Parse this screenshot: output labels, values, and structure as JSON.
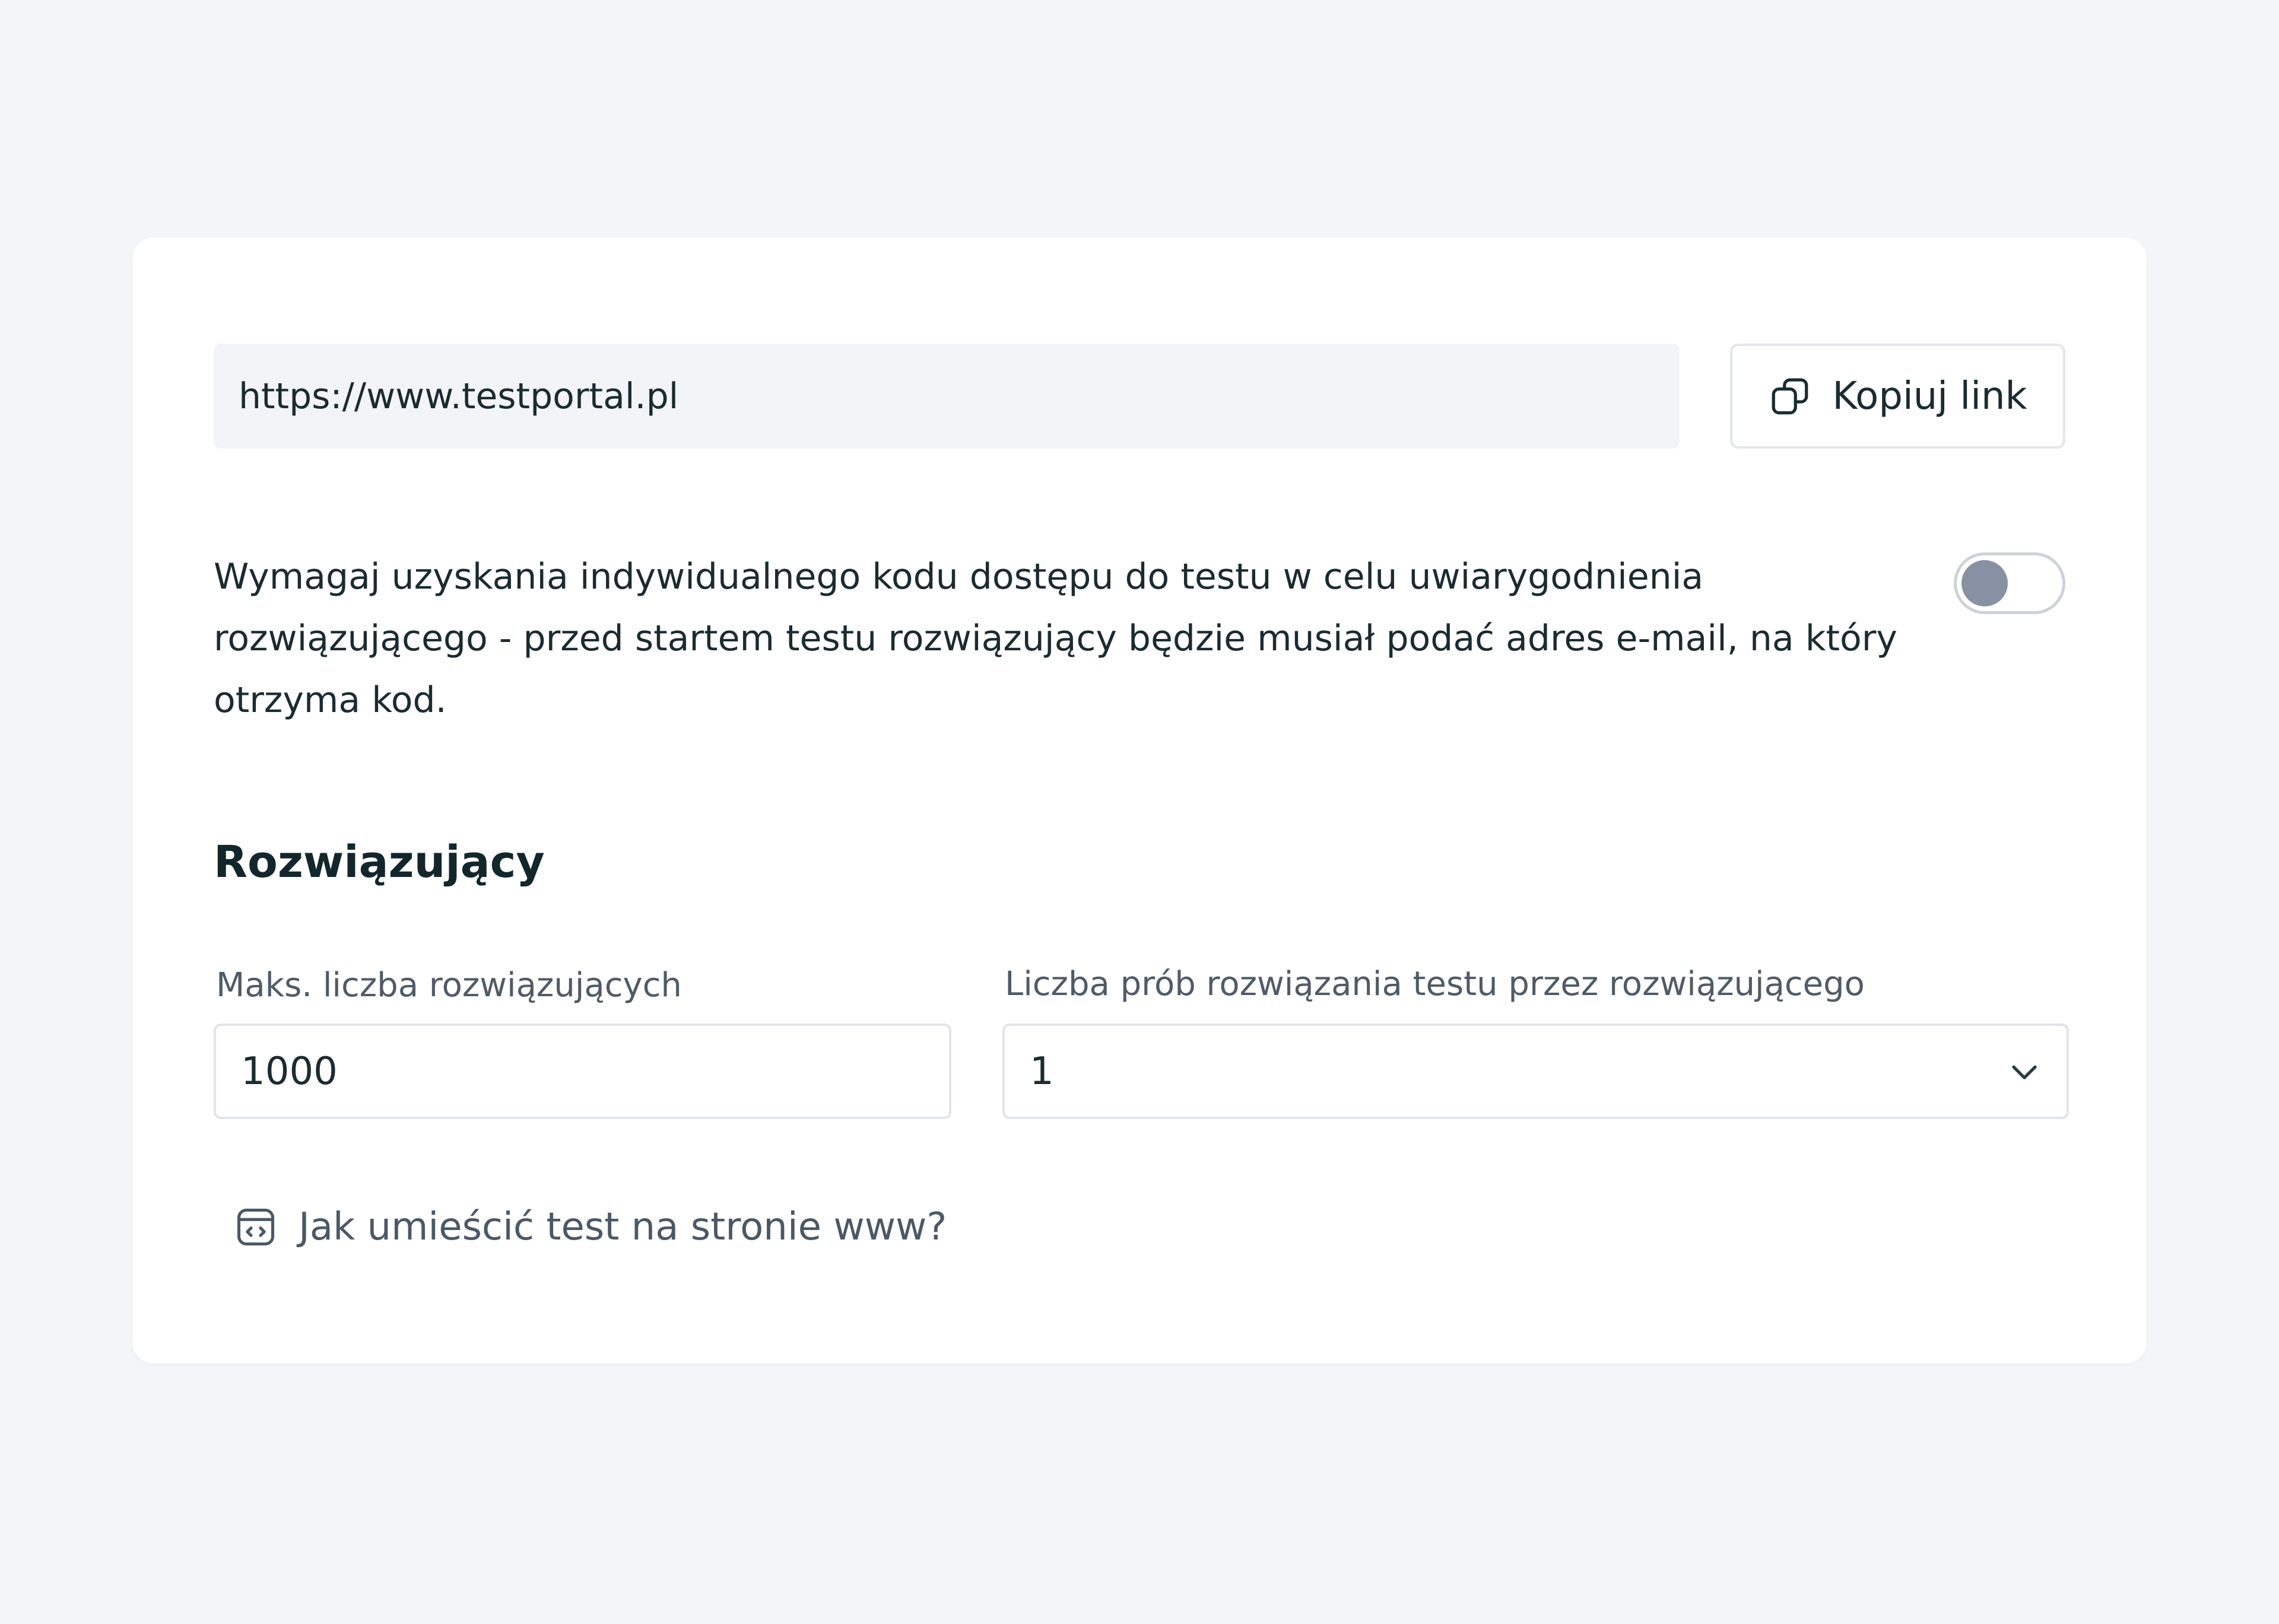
{
  "share": {
    "url": "https://www.testportal.pl",
    "copy_button_label": "Kopiuj link",
    "copy_icon": "copy-icon"
  },
  "access_code": {
    "description": "Wymagaj uzyskania indywidualnego kodu dostępu do testu w celu uwiarygodnienia rozwiązującego - przed startem testu rozwiązujący będzie musiał podać adres e-mail, na który otrzyma kod.",
    "enabled": false
  },
  "solvers": {
    "section_title": "Rozwiązujący",
    "max_solvers_label": "Maks. liczba rozwiązujących",
    "max_solvers_value": "1000",
    "attempts_label": "Liczba prób rozwiązania testu przez rozwiązującego",
    "attempts_value": "1",
    "attempts_icon": "chevron-down-icon"
  },
  "embed": {
    "link_label": "Jak umieścić test na stronie www?",
    "icon": "code-window-icon"
  },
  "colors": {
    "page_background": "#f4f5f8",
    "card_background": "#ffffff",
    "text_primary": "#1b2b30",
    "text_secondary": "#4f5b67",
    "toggle_knob": "#8791a3"
  }
}
